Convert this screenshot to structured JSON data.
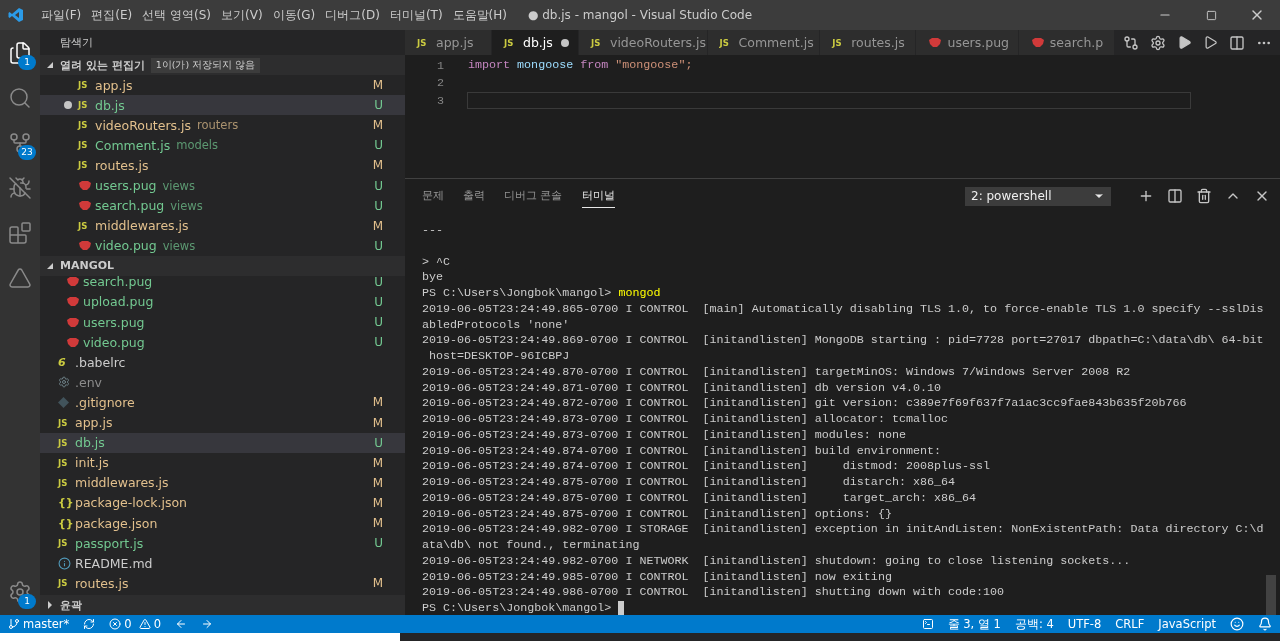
{
  "window": {
    "title": "● db.js - mangol - Visual Studio Code",
    "menu": [
      "파일(F)",
      "편집(E)",
      "선택 영역(S)",
      "보기(V)",
      "이동(G)",
      "디버그(D)",
      "터미널(T)",
      "도움말(H)"
    ]
  },
  "activity_bar": [
    {
      "kind": "files",
      "badge": "1",
      "selected": true
    },
    {
      "kind": "search",
      "selected": false
    },
    {
      "kind": "source-control",
      "badge": "23",
      "selected": false
    },
    {
      "kind": "debug",
      "selected": false
    },
    {
      "kind": "extensions",
      "selected": false
    },
    {
      "kind": "azure",
      "selected": false
    }
  ],
  "manage_badge": "1",
  "sidebar": {
    "title": "탐색기",
    "open_editors": {
      "title": "열려 있는 편집기",
      "badge": "1이(가) 저장되지 않음",
      "expanded": true,
      "items": [
        {
          "kind": "js",
          "glyph": "JS",
          "name": "app.js",
          "git": "M",
          "color": "#e2c08d",
          "dirty": false,
          "selected": false
        },
        {
          "kind": "js",
          "glyph": "JS",
          "name": "db.js",
          "git": "U",
          "color": "#73c991",
          "dirty": true,
          "selected": true
        },
        {
          "kind": "js",
          "glyph": "JS",
          "name": "videoRouters.js",
          "folder": "routers",
          "git": "M",
          "color": "#e2c08d",
          "dirty": false,
          "selected": false
        },
        {
          "kind": "js",
          "glyph": "JS",
          "name": "Comment.js",
          "folder": "models",
          "git": "U",
          "color": "#73c991",
          "dirty": false,
          "selected": false
        },
        {
          "kind": "js",
          "glyph": "JS",
          "name": "routes.js",
          "git": "M",
          "color": "#e2c08d",
          "dirty": false,
          "selected": false
        },
        {
          "kind": "pug",
          "name": "users.pug",
          "folder": "views",
          "git": "U",
          "color": "#73c991",
          "dirty": false,
          "selected": false
        },
        {
          "kind": "pug",
          "name": "search.pug",
          "folder": "views",
          "git": "U",
          "color": "#73c991",
          "dirty": false,
          "selected": false
        },
        {
          "kind": "js",
          "glyph": "JS",
          "name": "middlewares.js",
          "git": "M",
          "color": "#e2c08d",
          "dirty": false,
          "selected": false
        },
        {
          "kind": "pug",
          "name": "video.pug",
          "folder": "views",
          "git": "U",
          "color": "#73c991",
          "dirty": false,
          "selected": false
        }
      ]
    },
    "folder": {
      "title": "MANGOL",
      "expanded": true,
      "items": [
        {
          "kind": "group",
          "children": [
            {
              "kind": "pug",
              "name": "search.pug",
              "git": "U",
              "color": "#73c991",
              "selected": false
            },
            {
              "kind": "pug",
              "name": "upload.pug",
              "git": "U",
              "color": "#73c991",
              "selected": false
            },
            {
              "kind": "pug",
              "name": "users.pug",
              "git": "U",
              "color": "#73c991",
              "selected": false
            },
            {
              "kind": "pug",
              "name": "video.pug",
              "git": "U",
              "color": "#73c991",
              "selected": false
            }
          ]
        },
        {
          "kind": "babel",
          "glyph": "6",
          "name": ".babelrc",
          "color": "#cccccc",
          "selected": false
        },
        {
          "kind": "env",
          "name": ".env",
          "color": "#8c8c8c",
          "selected": false
        },
        {
          "kind": "git",
          "name": ".gitignore",
          "git": "M",
          "color": "#e2c08d",
          "selected": false
        },
        {
          "kind": "js",
          "glyph": "JS",
          "name": "app.js",
          "git": "M",
          "color": "#e2c08d",
          "selected": false
        },
        {
          "kind": "js",
          "glyph": "JS",
          "name": "db.js",
          "git": "U",
          "color": "#73c991",
          "selected": true
        },
        {
          "kind": "js",
          "glyph": "JS",
          "name": "init.js",
          "git": "M",
          "color": "#e2c08d",
          "selected": false
        },
        {
          "kind": "js",
          "glyph": "JS",
          "name": "middlewares.js",
          "git": "M",
          "color": "#e2c08d",
          "selected": false
        },
        {
          "kind": "json",
          "glyph": "{}",
          "name": "package-lock.json",
          "git": "M",
          "color": "#e2c08d",
          "selected": false
        },
        {
          "kind": "json",
          "glyph": "{}",
          "name": "package.json",
          "git": "M",
          "color": "#e2c08d",
          "selected": false
        },
        {
          "kind": "js",
          "glyph": "JS",
          "name": "passport.js",
          "git": "U",
          "color": "#73c991",
          "selected": false
        },
        {
          "kind": "info",
          "name": "README.md",
          "color": "#cccccc",
          "selected": false
        },
        {
          "kind": "js",
          "glyph": "JS",
          "name": "routes.js",
          "git": "M",
          "color": "#e2c08d",
          "selected": false
        }
      ]
    },
    "outline": {
      "title": "윤곽",
      "expanded": false
    }
  },
  "tabs": [
    {
      "kind": "js",
      "glyph": "JS",
      "label": "app.js",
      "selected": false,
      "dirty": false
    },
    {
      "kind": "js",
      "glyph": "JS",
      "label": "db.js",
      "selected": true,
      "dirty": true
    },
    {
      "kind": "js",
      "glyph": "JS",
      "label": "videoRouters.js",
      "selected": false,
      "dirty": false
    },
    {
      "kind": "js",
      "glyph": "JS",
      "label": "Comment.js",
      "selected": false,
      "dirty": false
    },
    {
      "kind": "js",
      "glyph": "JS",
      "label": "routes.js",
      "selected": false,
      "dirty": false
    },
    {
      "kind": "pug",
      "label": "users.pug",
      "selected": false,
      "dirty": false
    },
    {
      "kind": "pug",
      "label": "search.p",
      "selected": false,
      "dirty": false
    }
  ],
  "editor": {
    "lines": [
      {
        "number": "1",
        "current": false,
        "tokens": [
          {
            "kind": "keyword",
            "text": "import"
          },
          {
            "kind": "variable",
            "text": "mongoose"
          },
          {
            "kind": "keyword",
            "text": "from"
          },
          {
            "kind": "string",
            "text": "\"mongoose\";"
          }
        ]
      },
      {
        "number": "2",
        "current": false
      },
      {
        "number": "3",
        "current": true
      }
    ]
  },
  "panel": {
    "tabs": [
      {
        "label": "문제",
        "selected": false
      },
      {
        "label": "출력",
        "selected": false
      },
      {
        "label": "디버그 콘솔",
        "selected": false
      },
      {
        "label": "터미널",
        "selected": true
      }
    ],
    "terminal_select": "2: powershell",
    "lines": [
      {
        "kind": "text",
        "text": "---"
      },
      {
        "kind": "blank"
      },
      {
        "kind": "text",
        "text": "> ^C"
      },
      {
        "kind": "text",
        "text": "bye"
      },
      {
        "kind": "prompt",
        "text": "PS C:\\Users\\Jongbok\\mangol> ",
        "command": "mongod",
        "cursor": false
      },
      {
        "kind": "text",
        "text": "2019-06-05T23:24:49.865-0700 I CONTROL  [main] Automatically disabling TLS 1.0, to force-enable TLS 1.0 specify --sslDis"
      },
      {
        "kind": "text",
        "text": "abledProtocols 'none'"
      },
      {
        "kind": "text",
        "text": "2019-06-05T23:24:49.869-0700 I CONTROL  [initandlisten] MongoDB starting : pid=7728 port=27017 dbpath=C:\\data\\db\\ 64-bit"
      },
      {
        "kind": "text",
        "text": " host=DESKTOP-96ICBPJ"
      },
      {
        "kind": "text",
        "text": "2019-06-05T23:24:49.870-0700 I CONTROL  [initandlisten] targetMinOS: Windows 7/Windows Server 2008 R2"
      },
      {
        "kind": "text",
        "text": "2019-06-05T23:24:49.871-0700 I CONTROL  [initandlisten] db version v4.0.10"
      },
      {
        "kind": "text",
        "text": "2019-06-05T23:24:49.872-0700 I CONTROL  [initandlisten] git version: c389e7f69f637f7a1ac3cc9fae843b635f20b766"
      },
      {
        "kind": "text",
        "text": "2019-06-05T23:24:49.873-0700 I CONTROL  [initandlisten] allocator: tcmalloc"
      },
      {
        "kind": "text",
        "text": "2019-06-05T23:24:49.873-0700 I CONTROL  [initandlisten] modules: none"
      },
      {
        "kind": "text",
        "text": "2019-06-05T23:24:49.874-0700 I CONTROL  [initandlisten] build environment:"
      },
      {
        "kind": "text",
        "text": "2019-06-05T23:24:49.874-0700 I CONTROL  [initandlisten]     distmod: 2008plus-ssl"
      },
      {
        "kind": "text",
        "text": "2019-06-05T23:24:49.875-0700 I CONTROL  [initandlisten]     distarch: x86_64"
      },
      {
        "kind": "text",
        "text": "2019-06-05T23:24:49.875-0700 I CONTROL  [initandlisten]     target_arch: x86_64"
      },
      {
        "kind": "text",
        "text": "2019-06-05T23:24:49.875-0700 I CONTROL  [initandlisten] options: {}"
      },
      {
        "kind": "text",
        "text": "2019-06-05T23:24:49.982-0700 I STORAGE  [initandlisten] exception in initAndListen: NonExistentPath: Data directory C:\\d"
      },
      {
        "kind": "text",
        "text": "ata\\db\\ not found., terminating"
      },
      {
        "kind": "text",
        "text": "2019-06-05T23:24:49.982-0700 I NETWORK  [initandlisten] shutdown: going to close listening sockets..."
      },
      {
        "kind": "text",
        "text": "2019-06-05T23:24:49.985-0700 I CONTROL  [initandlisten] now exiting"
      },
      {
        "kind": "text",
        "text": "2019-06-05T23:24:49.986-0700 I CONTROL  [initandlisten] shutting down with code:100"
      },
      {
        "kind": "prompt",
        "text": "PS C:\\Users\\Jongbok\\mangol> ",
        "cursor": true
      }
    ]
  },
  "status_bar": {
    "branch": "master*",
    "errors": "0",
    "warnings": "0",
    "position": "줄 3, 열 1",
    "indent": "공백: 4",
    "encoding": "UTF-8",
    "eol": "CRLF",
    "language": "JavaScript"
  }
}
